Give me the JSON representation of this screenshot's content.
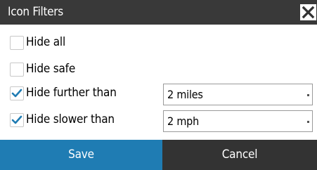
{
  "dialog": {
    "title": "Icon Filters"
  },
  "filters": [
    {
      "label": "Hide all",
      "checked": false
    },
    {
      "label": "Hide safe",
      "checked": false
    },
    {
      "label": "Hide further than",
      "checked": true,
      "value": "2 miles"
    },
    {
      "label": "Hide slower than",
      "checked": true,
      "value": "2 mph"
    }
  ],
  "footer": {
    "save_label": "Save",
    "cancel_label": "Cancel"
  },
  "colors": {
    "titlebar": "#393939",
    "save_button": "#1f7cb3",
    "cancel_button": "#333333",
    "checkmark": "#1f7cb3"
  },
  "icons": {
    "close": "close-icon",
    "check": "checkmark-icon",
    "dropdown": "dropdown-arrow-icon"
  }
}
